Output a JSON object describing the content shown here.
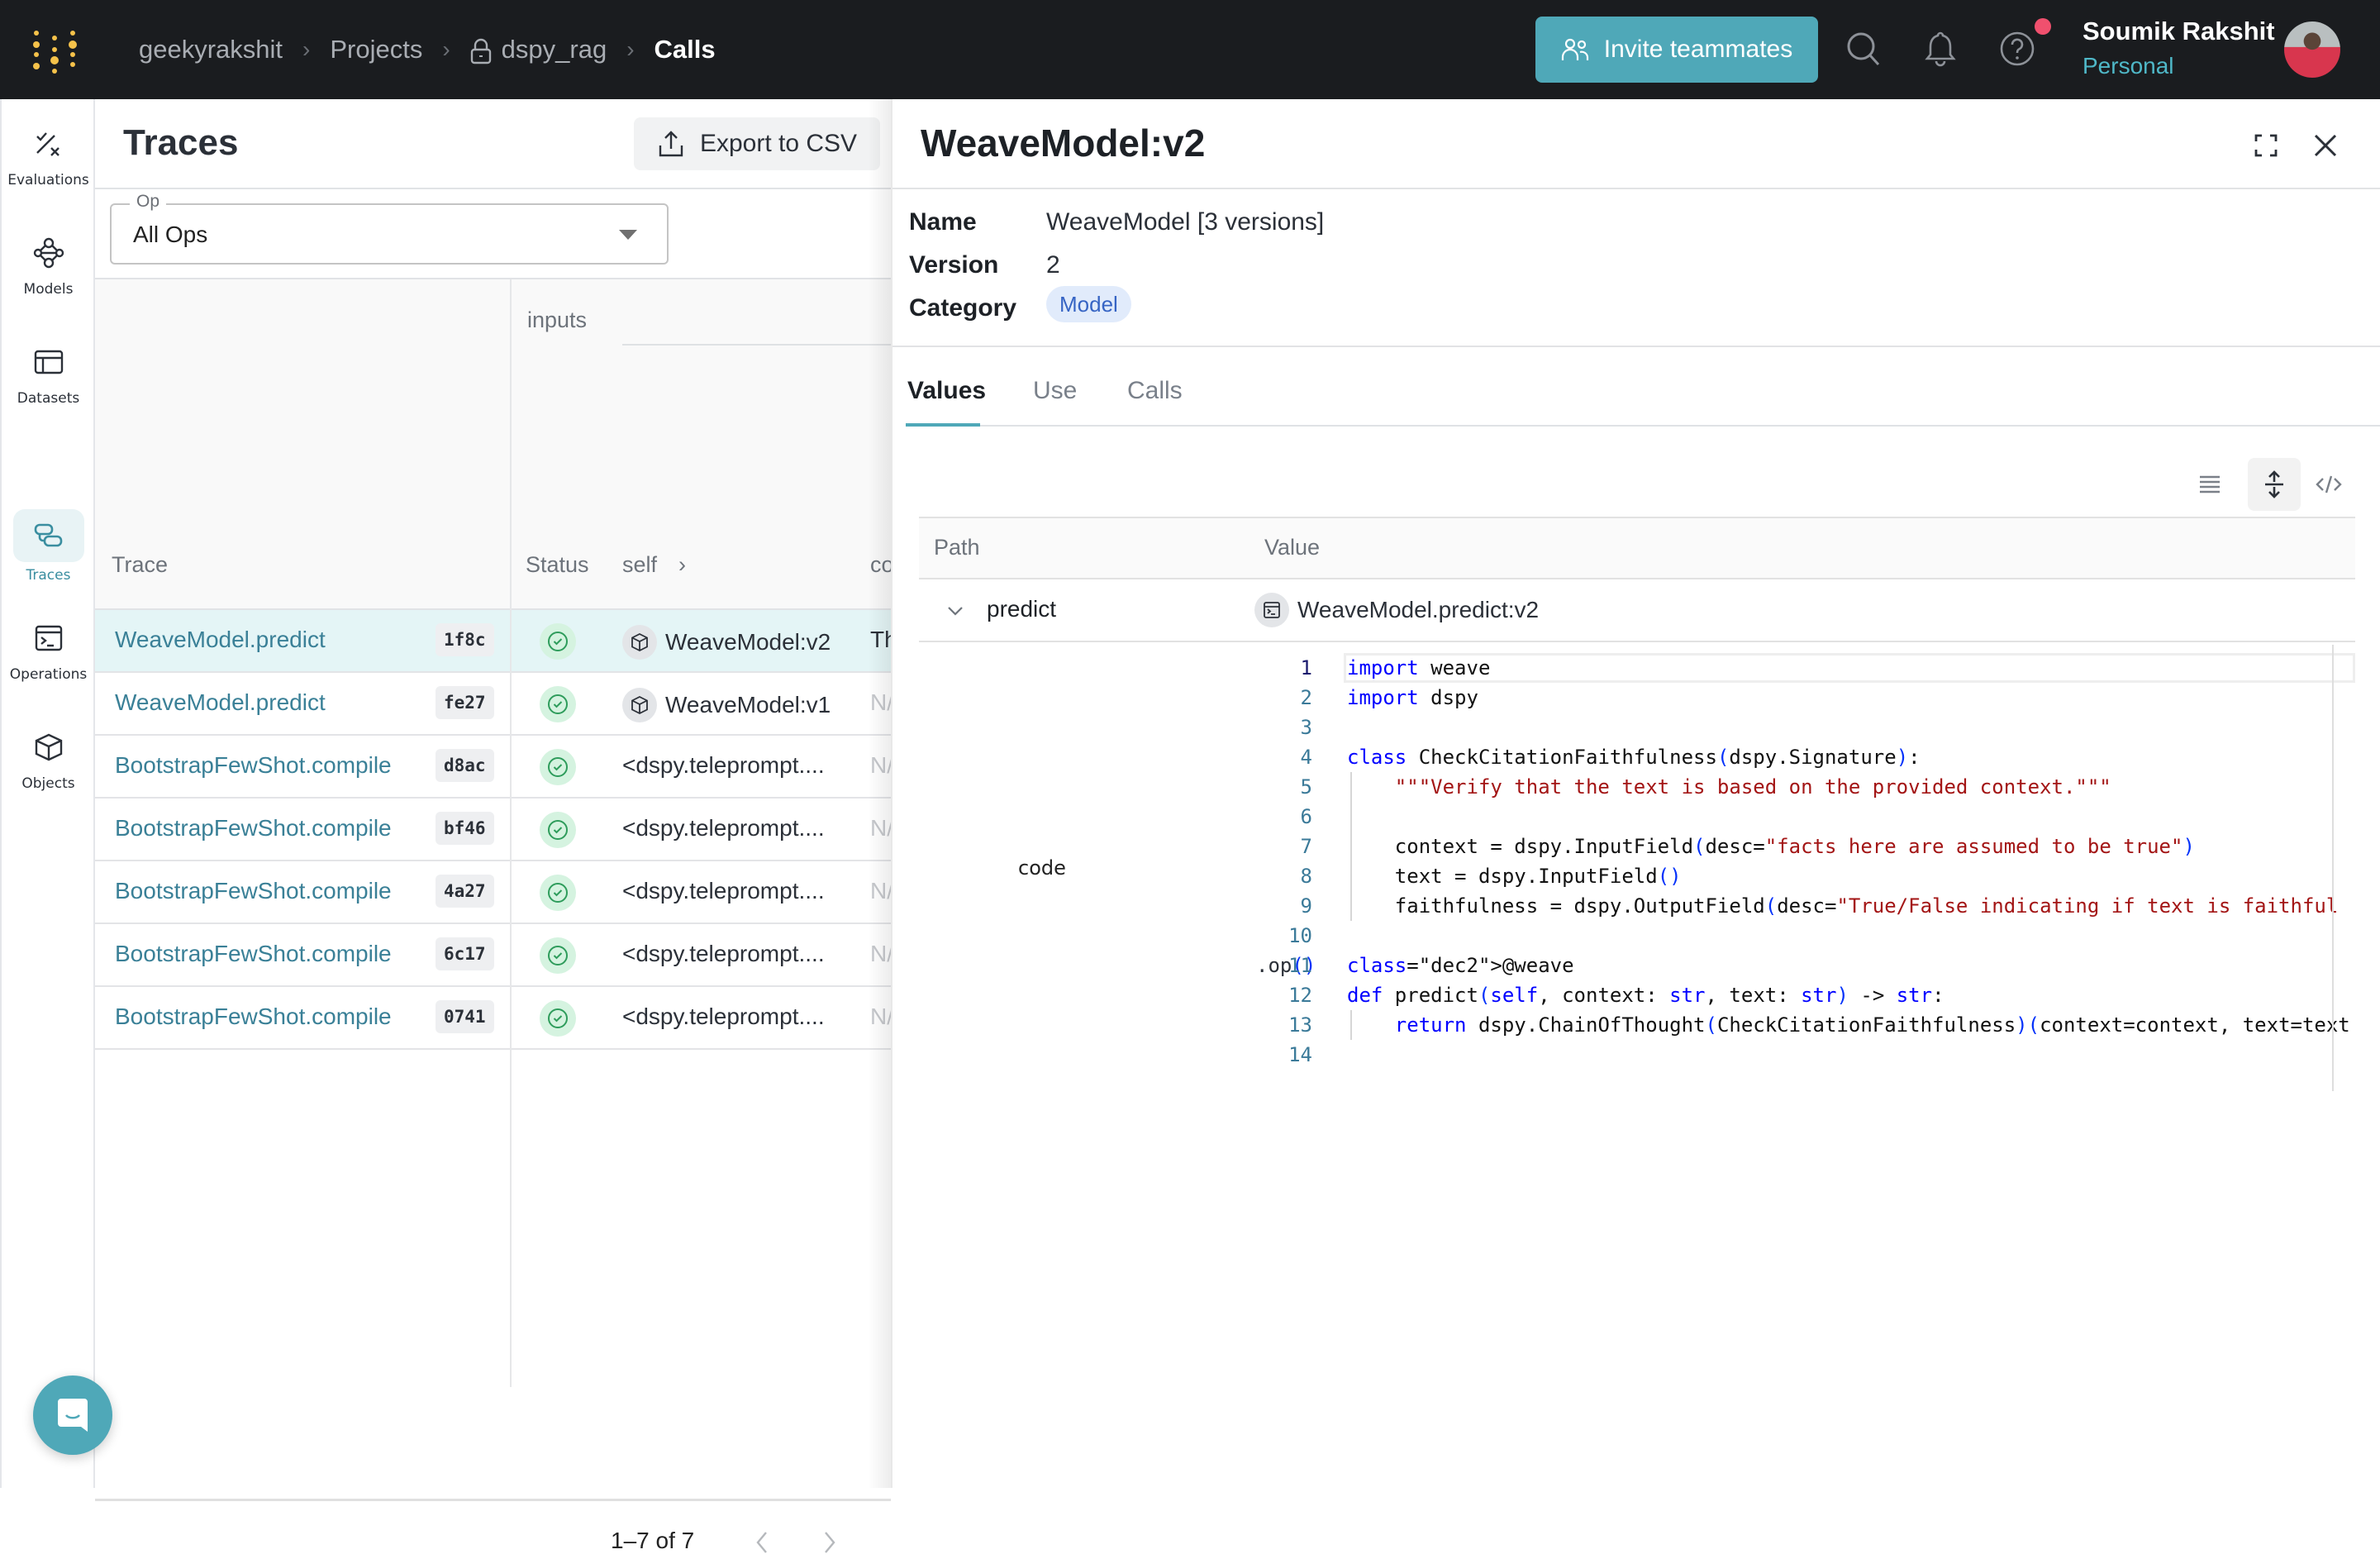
{
  "topbar": {
    "breadcrumb": [
      "geekyrakshit",
      "Projects",
      "dspy_rag",
      "Calls"
    ],
    "breadcrumb_locked_index": 2,
    "invite_label": "Invite teammates",
    "user_name": "Soumik Rakshit",
    "user_org": "Personal",
    "icons": [
      "search-icon",
      "bell-icon",
      "help-icon"
    ],
    "has_notification": true
  },
  "sidebar": {
    "items": [
      {
        "label": "Evaluations",
        "icon": "evaluations-icon",
        "active": false
      },
      {
        "label": "Models",
        "icon": "models-icon",
        "active": false
      },
      {
        "label": "Datasets",
        "icon": "datasets-icon",
        "active": false
      },
      {
        "label": "Traces",
        "icon": "traces-icon",
        "active": true
      },
      {
        "label": "Operations",
        "icon": "operations-icon",
        "active": false
      },
      {
        "label": "Objects",
        "icon": "objects-icon",
        "active": false
      }
    ]
  },
  "traces": {
    "title": "Traces",
    "export_label": "Export to CSV",
    "filter": {
      "label": "Op",
      "value": "All Ops"
    },
    "group_header": "inputs",
    "columns": {
      "trace": "Trace",
      "status": "Status",
      "self": "self",
      "context": "co"
    },
    "rows": [
      {
        "op": "WeaveModel.predict",
        "id": "1f8c",
        "status": "success",
        "self": "WeaveModel:v2",
        "self_is_ref": true,
        "context": "Th",
        "selected": true
      },
      {
        "op": "WeaveModel.predict",
        "id": "fe27",
        "status": "success",
        "self": "WeaveModel:v1",
        "self_is_ref": true,
        "context": "N/",
        "selected": false
      },
      {
        "op": "BootstrapFewShot.compile",
        "id": "d8ac",
        "status": "success",
        "self": "<dspy.teleprompt....",
        "self_is_ref": false,
        "context": "N/",
        "selected": false
      },
      {
        "op": "BootstrapFewShot.compile",
        "id": "bf46",
        "status": "success",
        "self": "<dspy.teleprompt....",
        "self_is_ref": false,
        "context": "N/",
        "selected": false
      },
      {
        "op": "BootstrapFewShot.compile",
        "id": "4a27",
        "status": "success",
        "self": "<dspy.teleprompt....",
        "self_is_ref": false,
        "context": "N/",
        "selected": false
      },
      {
        "op": "BootstrapFewShot.compile",
        "id": "6c17",
        "status": "success",
        "self": "<dspy.teleprompt....",
        "self_is_ref": false,
        "context": "N/",
        "selected": false
      },
      {
        "op": "BootstrapFewShot.compile",
        "id": "0741",
        "status": "success",
        "self": "<dspy.teleprompt....",
        "self_is_ref": false,
        "context": "N/",
        "selected": false
      }
    ],
    "pagination": "1–7 of 7"
  },
  "drawer": {
    "title": "WeaveModel:v2",
    "meta": {
      "name_label": "Name",
      "name_value": "WeaveModel [3 versions]",
      "version_label": "Version",
      "version_value": "2",
      "category_label": "Category",
      "category_value": "Model"
    },
    "tabs": [
      {
        "label": "Values",
        "active": true
      },
      {
        "label": "Use",
        "active": false
      },
      {
        "label": "Calls",
        "active": false
      }
    ],
    "view_modes": [
      "list-view-icon",
      "expand-rows-icon",
      "code-view-icon"
    ],
    "active_view_mode": 1,
    "table": {
      "path_header": "Path",
      "value_header": "Value",
      "row": {
        "path": "predict",
        "value": "WeaveModel.predict:v2"
      },
      "code_label": "code"
    },
    "code_lines": [
      "import weave",
      "import dspy",
      "",
      "class CheckCitationFaithfulness(dspy.Signature):",
      "    \"\"\"Verify that the text is based on the provided context.\"\"\"",
      "",
      "    context = dspy.InputField(desc=\"facts here are assumed to be true\")",
      "    text = dspy.InputField()",
      "    faithfulness = dspy.OutputField(desc=\"True/False indicating if text is faithful",
      "",
      "@weave.op()",
      "def predict(self, context: str, text: str) -> str:",
      "    return dspy.ChainOfThought(CheckCitationFaithfulness)(context=context, text=text",
      ""
    ],
    "current_line": 1
  },
  "colors": {
    "accent": "#4fa8b8",
    "topbar_bg": "#1a1c1f",
    "link": "#3a8097",
    "success": "#2e9c5b",
    "selected_row": "#e4f5f6",
    "notification": "#f0506e"
  }
}
